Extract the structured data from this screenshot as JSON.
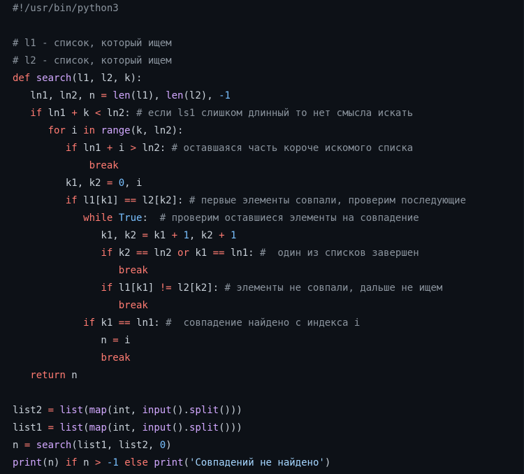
{
  "editor": {
    "background": "#0d1117",
    "colors": {
      "comment": "#8b949e",
      "keyword": "#ff7b72",
      "function": "#d2a8ff",
      "number": "#79c0ff",
      "string": "#a5d6ff",
      "text": "#c9d1d9"
    },
    "lines": [
      [
        {
          "t": "c",
          "v": "#!/usr/bin/python3"
        }
      ],
      [],
      [
        {
          "t": "c",
          "v": "# l1 - список, который ищем"
        }
      ],
      [
        {
          "t": "c",
          "v": "# l2 - список, который ищем"
        }
      ],
      [
        {
          "t": "k",
          "v": "def"
        },
        {
          "t": "x",
          "v": " "
        },
        {
          "t": "f",
          "v": "search"
        },
        {
          "t": "x",
          "v": "(l1, l2, k):"
        }
      ],
      [
        {
          "t": "x",
          "v": "   ln1, ln2, n "
        },
        {
          "t": "o",
          "v": "="
        },
        {
          "t": "x",
          "v": " "
        },
        {
          "t": "b",
          "v": "len"
        },
        {
          "t": "x",
          "v": "(l1), "
        },
        {
          "t": "b",
          "v": "len"
        },
        {
          "t": "x",
          "v": "(l2), "
        },
        {
          "t": "n",
          "v": "-1"
        }
      ],
      [
        {
          "t": "x",
          "v": "   "
        },
        {
          "t": "k",
          "v": "if"
        },
        {
          "t": "x",
          "v": " ln1 "
        },
        {
          "t": "o",
          "v": "+"
        },
        {
          "t": "x",
          "v": " k "
        },
        {
          "t": "o",
          "v": "<"
        },
        {
          "t": "x",
          "v": " ln2: "
        },
        {
          "t": "c",
          "v": "# если ls1 слишком длинный то нет смысла искать"
        }
      ],
      [
        {
          "t": "x",
          "v": "      "
        },
        {
          "t": "k",
          "v": "for"
        },
        {
          "t": "x",
          "v": " i "
        },
        {
          "t": "k",
          "v": "in"
        },
        {
          "t": "x",
          "v": " "
        },
        {
          "t": "b",
          "v": "range"
        },
        {
          "t": "x",
          "v": "(k, ln2):"
        }
      ],
      [
        {
          "t": "x",
          "v": "         "
        },
        {
          "t": "k",
          "v": "if"
        },
        {
          "t": "x",
          "v": " ln1 "
        },
        {
          "t": "o",
          "v": "+"
        },
        {
          "t": "x",
          "v": " i "
        },
        {
          "t": "o",
          "v": ">"
        },
        {
          "t": "x",
          "v": " ln2: "
        },
        {
          "t": "c",
          "v": "# оставшаяся часть короче искомого списка"
        }
      ],
      [
        {
          "t": "x",
          "v": "             "
        },
        {
          "t": "k",
          "v": "break"
        }
      ],
      [
        {
          "t": "x",
          "v": "         k1, k2 "
        },
        {
          "t": "o",
          "v": "="
        },
        {
          "t": "x",
          "v": " "
        },
        {
          "t": "n",
          "v": "0"
        },
        {
          "t": "x",
          "v": ", i"
        }
      ],
      [
        {
          "t": "x",
          "v": "         "
        },
        {
          "t": "k",
          "v": "if"
        },
        {
          "t": "x",
          "v": " l1[k1] "
        },
        {
          "t": "o",
          "v": "=="
        },
        {
          "t": "x",
          "v": " l2[k2]: "
        },
        {
          "t": "c",
          "v": "# первые элементы совпали, проверим последующие"
        }
      ],
      [
        {
          "t": "x",
          "v": "            "
        },
        {
          "t": "k",
          "v": "while"
        },
        {
          "t": "x",
          "v": " "
        },
        {
          "t": "n",
          "v": "True"
        },
        {
          "t": "x",
          "v": ":  "
        },
        {
          "t": "c",
          "v": "# проверим оставшиеся элементы на совпадение"
        }
      ],
      [
        {
          "t": "x",
          "v": "               k1, k2 "
        },
        {
          "t": "o",
          "v": "="
        },
        {
          "t": "x",
          "v": " k1 "
        },
        {
          "t": "o",
          "v": "+"
        },
        {
          "t": "x",
          "v": " "
        },
        {
          "t": "n",
          "v": "1"
        },
        {
          "t": "x",
          "v": ", k2 "
        },
        {
          "t": "o",
          "v": "+"
        },
        {
          "t": "x",
          "v": " "
        },
        {
          "t": "n",
          "v": "1"
        }
      ],
      [
        {
          "t": "x",
          "v": "               "
        },
        {
          "t": "k",
          "v": "if"
        },
        {
          "t": "x",
          "v": " k2 "
        },
        {
          "t": "o",
          "v": "=="
        },
        {
          "t": "x",
          "v": " ln2 "
        },
        {
          "t": "k",
          "v": "or"
        },
        {
          "t": "x",
          "v": " k1 "
        },
        {
          "t": "o",
          "v": "=="
        },
        {
          "t": "x",
          "v": " ln1: "
        },
        {
          "t": "c",
          "v": "#  один из списков завершен"
        }
      ],
      [
        {
          "t": "x",
          "v": "                  "
        },
        {
          "t": "k",
          "v": "break"
        }
      ],
      [
        {
          "t": "x",
          "v": "               "
        },
        {
          "t": "k",
          "v": "if"
        },
        {
          "t": "x",
          "v": " l1[k1] "
        },
        {
          "t": "o",
          "v": "!="
        },
        {
          "t": "x",
          "v": " l2[k2]: "
        },
        {
          "t": "c",
          "v": "# элементы не совпали, дальше не ищем"
        }
      ],
      [
        {
          "t": "x",
          "v": "                  "
        },
        {
          "t": "k",
          "v": "break"
        }
      ],
      [
        {
          "t": "x",
          "v": "            "
        },
        {
          "t": "k",
          "v": "if"
        },
        {
          "t": "x",
          "v": " k1 "
        },
        {
          "t": "o",
          "v": "=="
        },
        {
          "t": "x",
          "v": " ln1: "
        },
        {
          "t": "c",
          "v": "#  совпадение найдено с индекса i"
        }
      ],
      [
        {
          "t": "x",
          "v": "               n "
        },
        {
          "t": "o",
          "v": "="
        },
        {
          "t": "x",
          "v": " i"
        }
      ],
      [
        {
          "t": "x",
          "v": "               "
        },
        {
          "t": "k",
          "v": "break"
        }
      ],
      [
        {
          "t": "x",
          "v": "   "
        },
        {
          "t": "k",
          "v": "return"
        },
        {
          "t": "x",
          "v": " n"
        }
      ],
      [],
      [
        {
          "t": "x",
          "v": "list2 "
        },
        {
          "t": "o",
          "v": "="
        },
        {
          "t": "x",
          "v": " "
        },
        {
          "t": "b",
          "v": "list"
        },
        {
          "t": "x",
          "v": "("
        },
        {
          "t": "b",
          "v": "map"
        },
        {
          "t": "x",
          "v": "(int, "
        },
        {
          "t": "b",
          "v": "input"
        },
        {
          "t": "x",
          "v": "()."
        },
        {
          "t": "b",
          "v": "split"
        },
        {
          "t": "x",
          "v": "()))"
        }
      ],
      [
        {
          "t": "x",
          "v": "list1 "
        },
        {
          "t": "o",
          "v": "="
        },
        {
          "t": "x",
          "v": " "
        },
        {
          "t": "b",
          "v": "list"
        },
        {
          "t": "x",
          "v": "("
        },
        {
          "t": "b",
          "v": "map"
        },
        {
          "t": "x",
          "v": "(int, "
        },
        {
          "t": "b",
          "v": "input"
        },
        {
          "t": "x",
          "v": "()."
        },
        {
          "t": "b",
          "v": "split"
        },
        {
          "t": "x",
          "v": "()))"
        }
      ],
      [
        {
          "t": "x",
          "v": "n "
        },
        {
          "t": "o",
          "v": "="
        },
        {
          "t": "x",
          "v": " "
        },
        {
          "t": "b",
          "v": "search"
        },
        {
          "t": "x",
          "v": "(list1, list2, "
        },
        {
          "t": "n",
          "v": "0"
        },
        {
          "t": "x",
          "v": ")"
        }
      ],
      [
        {
          "t": "b",
          "v": "print"
        },
        {
          "t": "x",
          "v": "(n) "
        },
        {
          "t": "k",
          "v": "if"
        },
        {
          "t": "x",
          "v": " n "
        },
        {
          "t": "o",
          "v": ">"
        },
        {
          "t": "x",
          "v": " "
        },
        {
          "t": "n",
          "v": "-1"
        },
        {
          "t": "x",
          "v": " "
        },
        {
          "t": "k",
          "v": "else"
        },
        {
          "t": "x",
          "v": " "
        },
        {
          "t": "b",
          "v": "print"
        },
        {
          "t": "x",
          "v": "("
        },
        {
          "t": "s",
          "v": "'Совпадений не найдено'"
        },
        {
          "t": "x",
          "v": ")"
        }
      ]
    ]
  }
}
